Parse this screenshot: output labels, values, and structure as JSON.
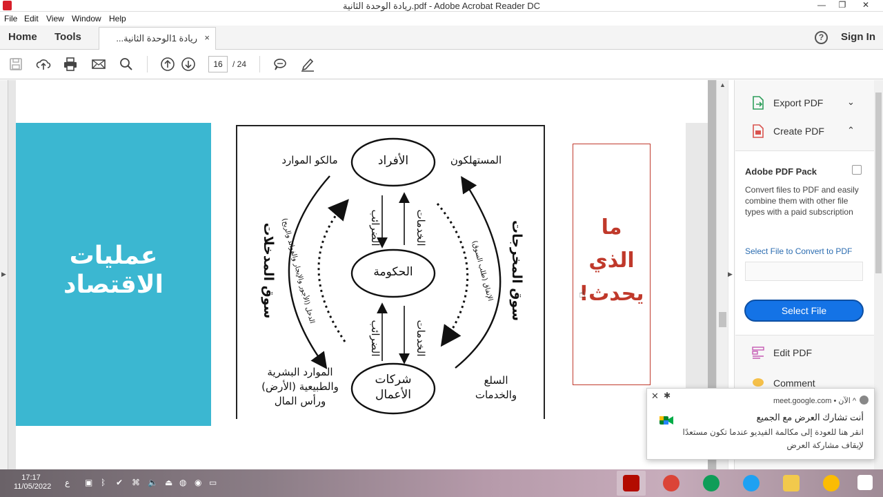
{
  "window": {
    "title": "ريادة الوحدة الثانية.pdf - Adobe Acrobat Reader DC",
    "minimize": "—",
    "maximize": "❐",
    "close": "✕"
  },
  "menu": [
    "File",
    "Edit",
    "View",
    "Window",
    "Help"
  ],
  "tabs": {
    "home": "Home",
    "tools": "Tools",
    "doc_tab": "ريادة 1الوحدة الثانية...",
    "doc_close": "×"
  },
  "header": {
    "help": "?",
    "sign_in": "Sign In"
  },
  "toolbar": {
    "page_current": "16",
    "page_total": "/ 24"
  },
  "slide": {
    "teal_title_line1": "عمليات",
    "teal_title_line2": "الاقتصاد",
    "red_line1": "ما",
    "red_line2": "الذي",
    "red_line3": "يحدث!",
    "diagram": {
      "individuals": "الأفراد",
      "government": "الحكومة",
      "businesses_line1": "شركات",
      "businesses_line2": "الأعمال",
      "resource_owners": "مالكو الموارد",
      "consumers": "المستهلكون",
      "input_market": "سوق المدخلات",
      "output_market": "سوق المخرجات",
      "taxes_top": "الضرائب",
      "services_top": "الخدمات",
      "taxes_bottom": "الضرائب",
      "services_bottom": "الخدمات",
      "income_label": "الدخل (الأجور والإيجار والفوائد والربح)",
      "spending_label": "الإنفاق (طلب السوق)",
      "resources_line1": "الموارد البشرية",
      "resources_line2": "والطبيعية (الأرض)",
      "resources_line3": "ورأس المال",
      "goods_line1": "السلع",
      "goods_line2": "والخدمات"
    }
  },
  "right_panel": {
    "export_pdf": "Export PDF",
    "create_pdf": "Create PDF",
    "pack_title": "Adobe PDF Pack",
    "pack_desc": "Convert files to PDF and easily combine them with other file types with a paid subscription",
    "select_convert": "Select File to Convert to PDF",
    "select_file_btn": "Select File",
    "edit_pdf": "Edit PDF",
    "comment": "Comment"
  },
  "notification": {
    "source": "meet.google.com • الآن ^",
    "title": "أنت تشارك العرض مع الجميع",
    "body": "انقر هنا للعودة إلى مكالمة الفيديو عندما تكون مستعدًا لإيقاف مشاركة العرض"
  },
  "taskbar": {
    "time": "17:17",
    "date": "11/05/2022",
    "lang": "ع"
  },
  "colors": {
    "accent_blue": "#1473e6",
    "teal": "#3bb7d1",
    "red": "#c0392b",
    "acrobat_red": "#d71f2a"
  }
}
